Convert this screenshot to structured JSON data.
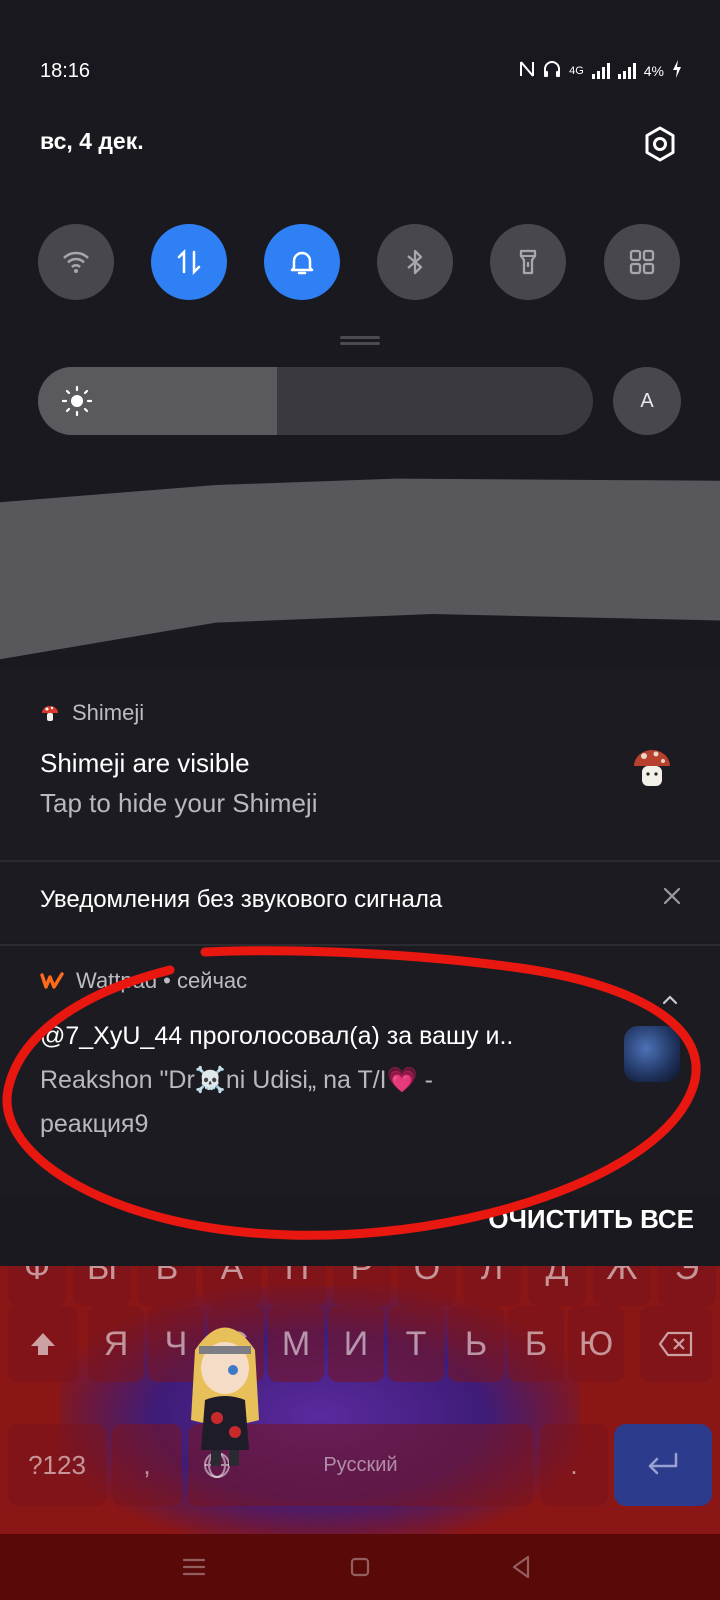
{
  "status_bar": {
    "time": "18:16",
    "network": "4G",
    "battery": "4%"
  },
  "header": {
    "date": "вс, 4 дек."
  },
  "quick_settings": {
    "toggles": [
      {
        "name": "wifi",
        "icon": "wifi-icon",
        "active": false
      },
      {
        "name": "mobile-data",
        "icon": "data-arrows-icon",
        "active": true
      },
      {
        "name": "sound",
        "icon": "bell-icon",
        "active": true
      },
      {
        "name": "bluetooth",
        "icon": "bluetooth-icon",
        "active": false
      },
      {
        "name": "flashlight",
        "icon": "flashlight-icon",
        "active": false
      },
      {
        "name": "more",
        "icon": "grid-icon",
        "active": false
      }
    ],
    "brightness_level": 0.43,
    "auto_brightness_label": "A"
  },
  "notifications": {
    "shimeji": {
      "app_name": "Shimeji",
      "title": "Shimeji are visible",
      "text": "Tap to hide your Shimeji"
    },
    "silent_section": {
      "label": "Уведомления без звукового сигнала"
    },
    "wattpad": {
      "app_name": "Wattpad",
      "time": "• сейчас",
      "line1": "@7_XyU_44 проголосовал(а) за вашу и..",
      "line2": "Reakshon \"Dr☠️ni Udisi„ na T/I💗 -",
      "line3": "реакция9"
    },
    "clear_all_label": "ОЧИСТИТЬ ВСЕ"
  },
  "keyboard": {
    "row1": [
      "Ф",
      "Ы",
      "В",
      "А",
      "П",
      "Р",
      "О",
      "Л",
      "Д",
      "Ж",
      "Э"
    ],
    "row2": [
      "Я",
      "Ч",
      "С",
      "М",
      "И",
      "Т",
      "Ь",
      "Б",
      "Ю"
    ],
    "symbols_label": "?123",
    "comma_label": ",",
    "space_label": "Русский",
    "period_label": "."
  },
  "colors": {
    "accent": "#2f80f4",
    "panel": "#1c1b21",
    "annotation": "#e8170f",
    "keyboard_bg": "#8a1616"
  }
}
